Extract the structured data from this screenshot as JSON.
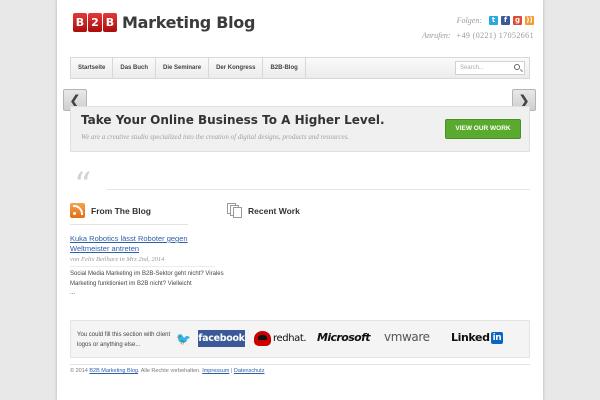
{
  "header": {
    "logo_badge": [
      "B",
      "2",
      "B"
    ],
    "logo_text": "Marketing Blog",
    "follow_label": "Folgen:",
    "social": [
      "twitter-icon",
      "facebook-icon",
      "google-plus-icon",
      "rss-icon"
    ],
    "social_glyphs": [
      "t",
      "f",
      "g",
      "))"
    ],
    "social_colors": [
      "#29a9e0",
      "#3b5998",
      "#dd4b39",
      "#f39a35"
    ],
    "call_label": "Anrufen:",
    "call_number": "+49 (0221) 17052661"
  },
  "nav": {
    "items": [
      "Startseite",
      "Das Buch",
      "Die Seminare",
      "Der Kongress",
      "B2B-Blog"
    ],
    "search_placeholder": "Search..."
  },
  "slider": {
    "prev": "❮",
    "next": "❯"
  },
  "callout": {
    "title": "Take Your Online Business To A Higher Level.",
    "subtitle": "We are a creative studio specialized into the creation of digital designs, products and resources.",
    "button": "VIEW OUR WORK",
    "button_color": "#5aaa30"
  },
  "quote_mark": "“",
  "blog": {
    "title": "From The Blog",
    "post_title": "Kuka Robotics lässt Roboter gegen Weltmeister antreten",
    "post_meta": "von Felix Beilharz in Mrz 2nd, 2014",
    "excerpt": "Social Media Marketing im B2B-Sektor geht nicht? Virales Marketing funktioniert im B2B nicht? Vielleicht",
    "more": "..."
  },
  "recent_work": {
    "title": "Recent Work"
  },
  "clients": {
    "text": "You could fill this section with client logos or anything else...",
    "twitter_glyph": "🐦",
    "facebook": "facebook",
    "redhat": "redhat.",
    "microsoft": "Microsoft",
    "vmware": "vmware",
    "linkedin_text": "Linked",
    "linkedin_box": "in"
  },
  "footer": {
    "prefix": "© 2014",
    "site_link": "B2B Marketing Blog",
    "rights": ". Alle Rechte vorbehalten.",
    "impressum": "Impressum",
    "divider": " | ",
    "datenschutz": "Datenschutz"
  }
}
